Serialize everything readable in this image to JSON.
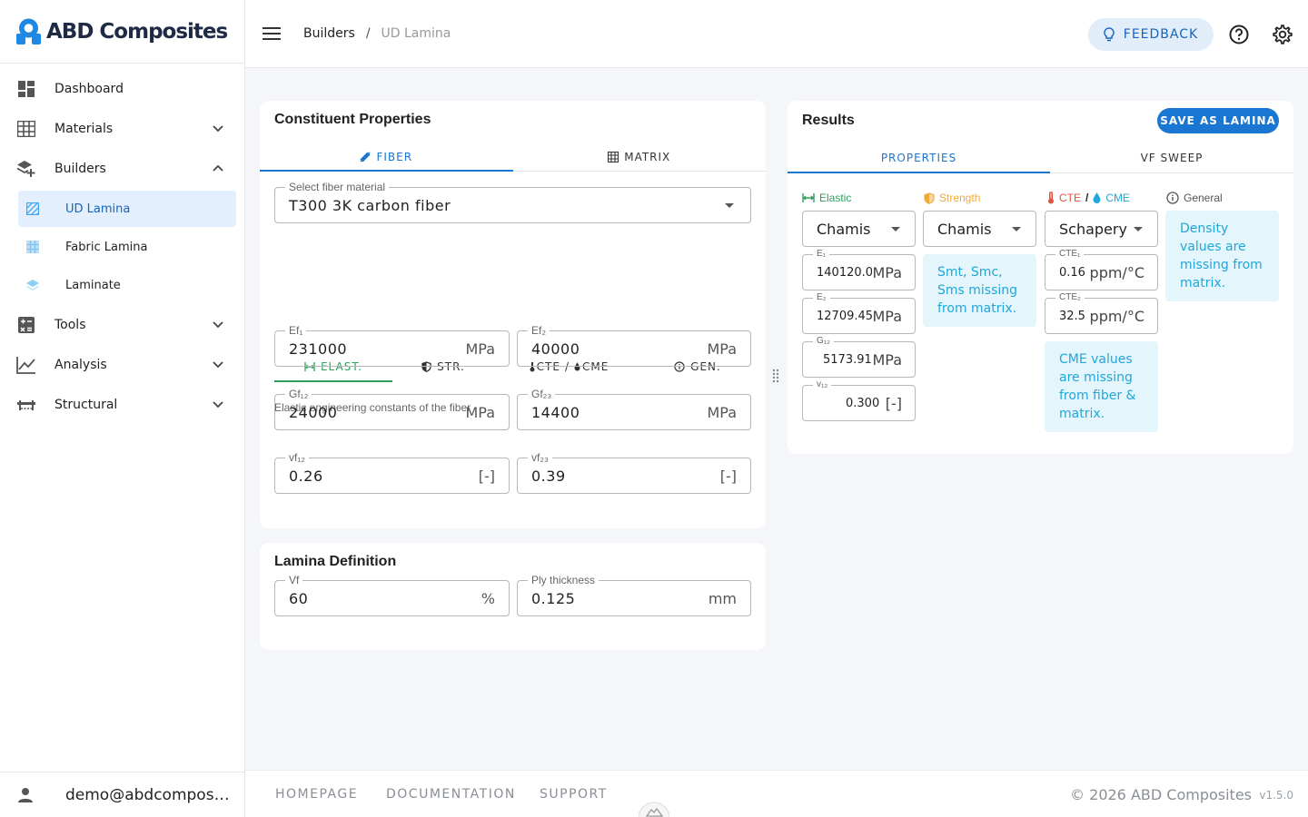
{
  "app": {
    "name": "ABD Composites"
  },
  "sidebar": {
    "items": [
      {
        "label": "Dashboard"
      },
      {
        "label": "Materials"
      },
      {
        "label": "Builders"
      },
      {
        "label": "Tools"
      },
      {
        "label": "Analysis"
      },
      {
        "label": "Structural"
      }
    ],
    "builders_sub": [
      {
        "label": "UD Lamina",
        "active": true
      },
      {
        "label": "Fabric Lamina"
      },
      {
        "label": "Laminate"
      }
    ],
    "user": "demo@abdcomposites.com"
  },
  "header": {
    "breadcrumb": [
      "Builders",
      "UD Lamina"
    ],
    "separator": "/",
    "feedback_label": "FEEDBACK"
  },
  "constituent": {
    "title": "Constituent Properties",
    "tabs": [
      "FIBER",
      "MATRIX"
    ],
    "select_label": "Select fiber material",
    "select_value": "T300 3K carbon fiber",
    "sub_tabs": [
      "ELAST.",
      "STR.",
      "CTE",
      "/",
      "CME",
      "GEN."
    ],
    "hint": "Elastic engineering constants of the fiber",
    "fields": [
      {
        "label": "Ef₁",
        "value": "231000",
        "unit": "MPa"
      },
      {
        "label": "Ef₂",
        "value": "40000",
        "unit": "MPa"
      },
      {
        "label": "Gf₁₂",
        "value": "24000",
        "unit": "MPa"
      },
      {
        "label": "Gf₂₃",
        "value": "14400",
        "unit": "MPa"
      },
      {
        "label": "vf₁₂",
        "value": "0.26",
        "unit": "[-]"
      },
      {
        "label": "vf₂₃",
        "value": "0.39",
        "unit": "[-]"
      }
    ]
  },
  "lamina": {
    "title": "Lamina Definition",
    "vf": {
      "label": "Vf",
      "value": "60",
      "unit": "%"
    },
    "ply": {
      "label": "Ply thickness",
      "value": "0.125",
      "unit": "mm"
    }
  },
  "results": {
    "title": "Results",
    "save_label": "SAVE AS LAMINA",
    "tabs": [
      "PROPERTIES",
      "VF SWEEP"
    ],
    "columns": {
      "elastic": "Elastic",
      "strength": "Strength",
      "cte": "CTE",
      "slash": "/",
      "cme": "CME",
      "general": "General"
    },
    "elastic_method": "Chamis",
    "strength_method": "Chamis",
    "cte_method": "Schapery",
    "elastic_fields": [
      {
        "label": "E₁",
        "value": "140120.00",
        "unit": "MPa"
      },
      {
        "label": "E₂",
        "value": "12709.455",
        "unit": "MPa"
      },
      {
        "label": "G₁₂",
        "value": "5173.915",
        "unit": "MPa"
      },
      {
        "label": "v₁₂",
        "value": "0.300",
        "unit": "[-]"
      }
    ],
    "cte_fields": [
      {
        "label": "CTE₁",
        "value": "0.16",
        "unit": "ppm/°C"
      },
      {
        "label": "CTE₂",
        "value": "32.5",
        "unit": "ppm/°C"
      }
    ],
    "strength_note": "Smt, Smc, Sms missing from matrix.",
    "cme_note": "CME values are missing from fiber & matrix.",
    "general_note": "Density values are missing from matrix."
  },
  "footer": {
    "links": [
      "HOMEPAGE",
      "DOCUMENTATION",
      "SUPPORT"
    ],
    "copyright": "© 2026 ABD Composites",
    "version": "v1.5.0"
  },
  "colors": {
    "primary": "#1976d2",
    "elastic": "#2e9e5b",
    "strength": "#f2a93b",
    "cte": "#e0533f",
    "cme": "#21a7d9"
  }
}
